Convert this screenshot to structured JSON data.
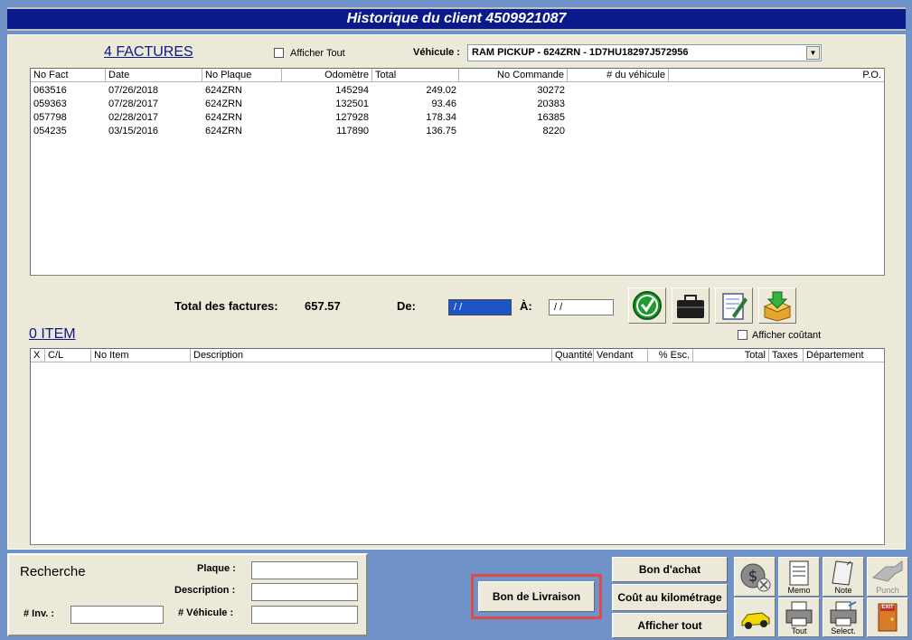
{
  "window": {
    "title": "Historique du client 4509921087"
  },
  "invoices": {
    "count_label": "4  FACTURES",
    "show_all_label": "Afficher Tout",
    "vehicle_label": "Véhicule :",
    "vehicle_value": "RAM PICKUP - 624ZRN - 1D7HU18297J572956",
    "columns": [
      "No Fact",
      "Date",
      "No Plaque",
      "Odomètre",
      "Total",
      "No Commande",
      "# du véhicule",
      "P.O."
    ],
    "rows": [
      {
        "no_fact": "063516",
        "date": "07/26/2018",
        "plaque": "624ZRN",
        "odometre": "145294",
        "total": "249.02",
        "commande": "30272"
      },
      {
        "no_fact": "059363",
        "date": "07/28/2017",
        "plaque": "624ZRN",
        "odometre": "132501",
        "total": "93.46",
        "commande": "20383"
      },
      {
        "no_fact": "057798",
        "date": "02/28/2017",
        "plaque": "624ZRN",
        "odometre": "127928",
        "total": "178.34",
        "commande": "16385"
      },
      {
        "no_fact": "054235",
        "date": "03/15/2016",
        "plaque": "624ZRN",
        "odometre": "117890",
        "total": "136.75",
        "commande": "8220"
      }
    ]
  },
  "totals": {
    "label": "Total des factures:",
    "value": "657.57",
    "from_label": "De:",
    "from_value": "/  /",
    "to_label": "À:",
    "to_value": "/ /"
  },
  "items": {
    "count_label": "0 ITEM",
    "show_cost_label": "Afficher coûtant",
    "columns": [
      "X",
      "C/L",
      "No Item",
      "Description",
      "Quantité",
      "Vendant",
      "% Esc.",
      "Total",
      "Taxes",
      "Département"
    ]
  },
  "search": {
    "title": "Recherche",
    "plaque_label": "Plaque :",
    "description_label": "Description :",
    "inv_label": "# Inv.  :",
    "vehicule_label": "# Véhicule :"
  },
  "buttons": {
    "bon_livraison": "Bon de Livraison",
    "bon_achat": "Bon d'achat",
    "cout_km": "Coût au kilométrage",
    "afficher_tout": "Afficher tout"
  },
  "toolbar": {
    "memo": "Memo",
    "note": "Note",
    "punch": "Punch",
    "tout": "Tout",
    "select": "Select.",
    "exit": "EXIT"
  },
  "colors": {
    "title_bg": "#0a1a8a",
    "panel_bg": "#ece9d8",
    "desktop_bg": "#6f92c9",
    "highlight_border": "#e0484a",
    "date_selected": "#1d54c7"
  }
}
